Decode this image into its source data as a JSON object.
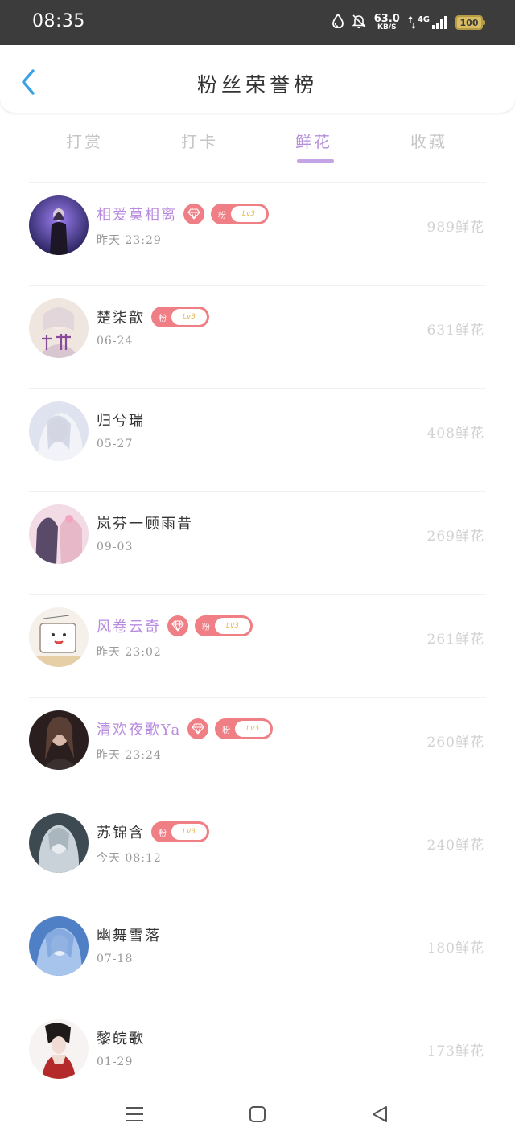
{
  "status_bar": {
    "time": "08:35",
    "speed_value": "63.0",
    "speed_unit": "KB/S",
    "network": "4G",
    "battery": "100",
    "icons": [
      "water-drop-icon",
      "bell-mute-icon",
      "signal-icon",
      "battery-icon"
    ]
  },
  "header": {
    "title": "粉丝荣誉榜",
    "back_icon": "chevron-left-icon"
  },
  "tabs": [
    {
      "label": "打赏",
      "active": false
    },
    {
      "label": "打卡",
      "active": false
    },
    {
      "label": "鲜花",
      "active": true
    },
    {
      "label": "收藏",
      "active": false
    }
  ],
  "colors": {
    "accent": "#b48fdc",
    "badge": "#f07e85",
    "muted": "#d2d2d2",
    "level_text": "#e8b84a"
  },
  "fan_badge": {
    "left": "粉",
    "level": "Lv3"
  },
  "rows": [
    {
      "name": "相爱莫相离",
      "vip": true,
      "diamond": true,
      "fan_badge": true,
      "time": "昨天 23:29",
      "count": "989鲜花"
    },
    {
      "name": "楚柒歆",
      "vip": false,
      "diamond": false,
      "fan_badge": true,
      "time": "06-24",
      "count": "631鲜花"
    },
    {
      "name": "归兮瑞",
      "vip": false,
      "diamond": false,
      "fan_badge": false,
      "time": "05-27",
      "count": "408鲜花"
    },
    {
      "name": "岚芬一顾雨昔",
      "vip": false,
      "diamond": false,
      "fan_badge": false,
      "time": "09-03",
      "count": "269鲜花"
    },
    {
      "name": "风卷云奇",
      "vip": true,
      "diamond": true,
      "fan_badge": true,
      "time": "昨天 23:02",
      "count": "261鲜花"
    },
    {
      "name": "清欢夜歌Ya",
      "vip": true,
      "diamond": true,
      "fan_badge": true,
      "time": "昨天 23:24",
      "count": "260鲜花"
    },
    {
      "name": "苏锦含",
      "vip": false,
      "diamond": false,
      "fan_badge": true,
      "time": "今天 08:12",
      "count": "240鲜花"
    },
    {
      "name": "幽舞雪落",
      "vip": false,
      "diamond": false,
      "fan_badge": false,
      "time": "07-18",
      "count": "180鲜花"
    },
    {
      "name": "黎皖歌",
      "vip": false,
      "diamond": false,
      "fan_badge": false,
      "time": "01-29",
      "count": "173鲜花"
    }
  ],
  "nav_bar": {
    "icons": [
      "menu-icon",
      "home-square-icon",
      "back-triangle-icon"
    ]
  }
}
